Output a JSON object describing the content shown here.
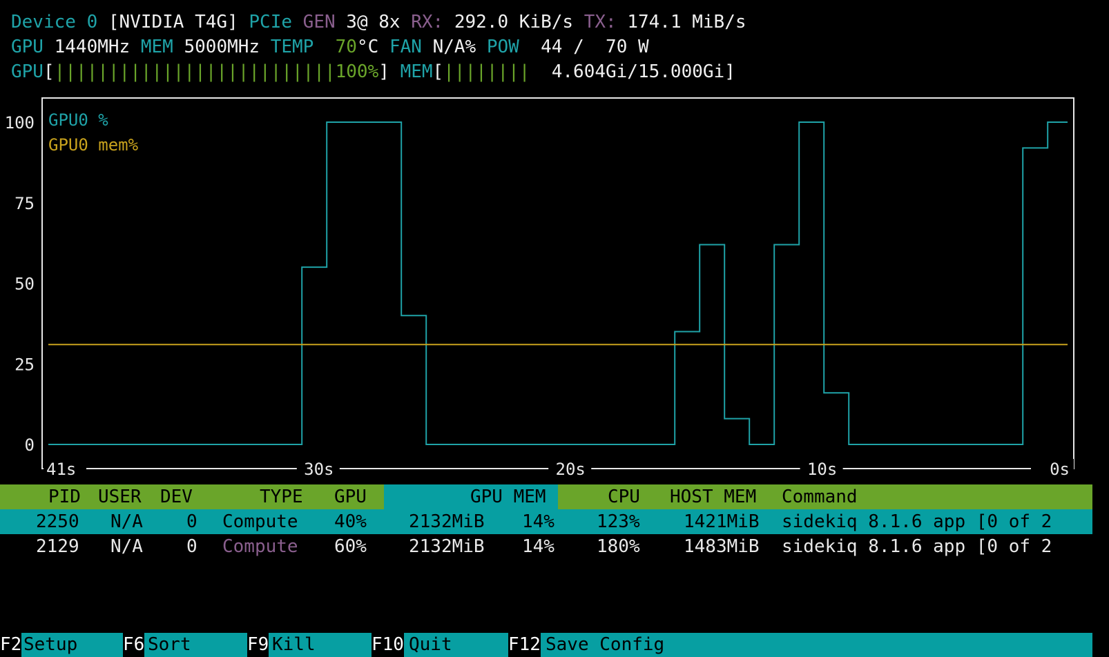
{
  "header": {
    "device_label": "Device 0",
    "device_name": "[NVIDIA T4G]",
    "pcie_label": "PCIe",
    "gen_label": "GEN",
    "gen_value": "3@ 8x",
    "rx_label": "RX:",
    "rx_value": "292.0 KiB/s",
    "tx_label": "TX:",
    "tx_value": "174.1 MiB/s",
    "gpu_label": "GPU",
    "gpu_clock": "1440MHz",
    "mem_label": "MEM",
    "mem_clock": "5000MHz",
    "temp_label": "TEMP",
    "temp_value": "70",
    "temp_unit": "°C",
    "fan_label": "FAN",
    "fan_value": "N/A%",
    "pow_label": "POW",
    "pow_value": "44 /  70 W",
    "gpu_bar_label": "GPU",
    "gpu_bar_text": "100%",
    "gpu_bar_fraction": 1.0,
    "mem_bar_label": "MEM",
    "mem_bar_text": "4.604Gi/15.000Gi",
    "mem_bar_fraction": 0.307
  },
  "colors": {
    "cyan": "#1fa3a8",
    "yellow": "#c8a21d",
    "green": "#6aa52a",
    "purple": "#8a5f8e",
    "teal_bar": "#079fa2"
  },
  "chart_data": {
    "type": "line",
    "legend": [
      "GPU0 %",
      "GPU0 mem%"
    ],
    "y_ticks": [
      "100",
      "75",
      "50",
      "25",
      "0"
    ],
    "x_ticks": [
      "41s",
      "30s",
      "20s",
      "10s",
      "0s"
    ],
    "ylim": [
      0,
      100
    ],
    "xlim": [
      41,
      0
    ],
    "series": [
      {
        "name": "GPU0 %",
        "color": "#1fa3a8",
        "x": [
          41,
          30.8,
          29.8,
          26.8,
          25.8,
          16.8,
          15.8,
          14.8,
          13.8,
          12.8,
          11.8,
          10.8,
          9.8,
          8.8,
          7.8,
          1.8,
          0.8
        ],
        "values": [
          0,
          55,
          100,
          40,
          0,
          0,
          35,
          62,
          8,
          0,
          62,
          100,
          16,
          0,
          0,
          92,
          100
        ]
      },
      {
        "name": "GPU0 mem%",
        "color": "#c8a21d",
        "x": [
          41,
          0
        ],
        "values": [
          31,
          31
        ]
      }
    ]
  },
  "process_table": {
    "columns": [
      "PID",
      "USER",
      "DEV",
      "TYPE",
      "GPU",
      "GPU MEM",
      "CPU",
      "HOST MEM",
      "Command"
    ],
    "rows": [
      {
        "pid": "2250",
        "user": "N/A",
        "dev": "0",
        "type": "Compute",
        "gpu": "40%",
        "gpu_mem": "2132MiB",
        "gpu_mem_pct": "14%",
        "cpu": "123%",
        "host_mem": "1421MiB",
        "command": "sidekiq 8.1.6 app [0 of 2"
      },
      {
        "pid": "2129",
        "user": "N/A",
        "dev": "0",
        "type": "Compute",
        "gpu": "60%",
        "gpu_mem": "2132MiB",
        "gpu_mem_pct": "14%",
        "cpu": "180%",
        "host_mem": "1483MiB",
        "command": "sidekiq 8.1.6 app [0 of 2"
      }
    ]
  },
  "footer": {
    "keys": [
      {
        "key": "F2",
        "label": "Setup"
      },
      {
        "key": "F6",
        "label": "Sort"
      },
      {
        "key": "F9",
        "label": "Kill"
      },
      {
        "key": "F10",
        "label": "Quit"
      },
      {
        "key": "F12",
        "label": "Save Config"
      }
    ]
  }
}
